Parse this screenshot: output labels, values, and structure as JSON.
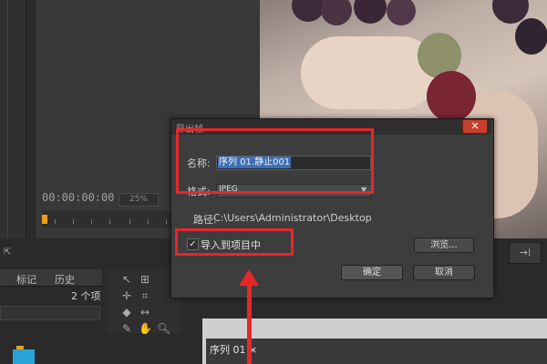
{
  "source_panel": {
    "timecode": "00:00:00:00",
    "zoom": "25%"
  },
  "project_panel": {
    "tabs": [
      "标记",
      "历史"
    ],
    "item_count": "2 个项"
  },
  "sequence_window": {
    "tab_label": "序列 01 ×"
  },
  "dialog": {
    "title": "导出帧",
    "close_icon": "✕",
    "name_label": "名称:",
    "name_value": "序列 01.静止001",
    "format_label": "格式:",
    "format_value": "JPEG",
    "path_label": "路径:",
    "path_value": "C:\\Users\\Administrator\\Desktop",
    "import_checkbox_checked": true,
    "import_label": "导入到项目中",
    "browse_button": "浏览...",
    "ok_button": "确定",
    "cancel_button": "取消"
  },
  "annotations": {
    "highlight_color": "#e8262a"
  },
  "colors": {
    "selection": "#3c6fb6",
    "close_button": "#c8402c",
    "playhead": "#e8a21b"
  }
}
